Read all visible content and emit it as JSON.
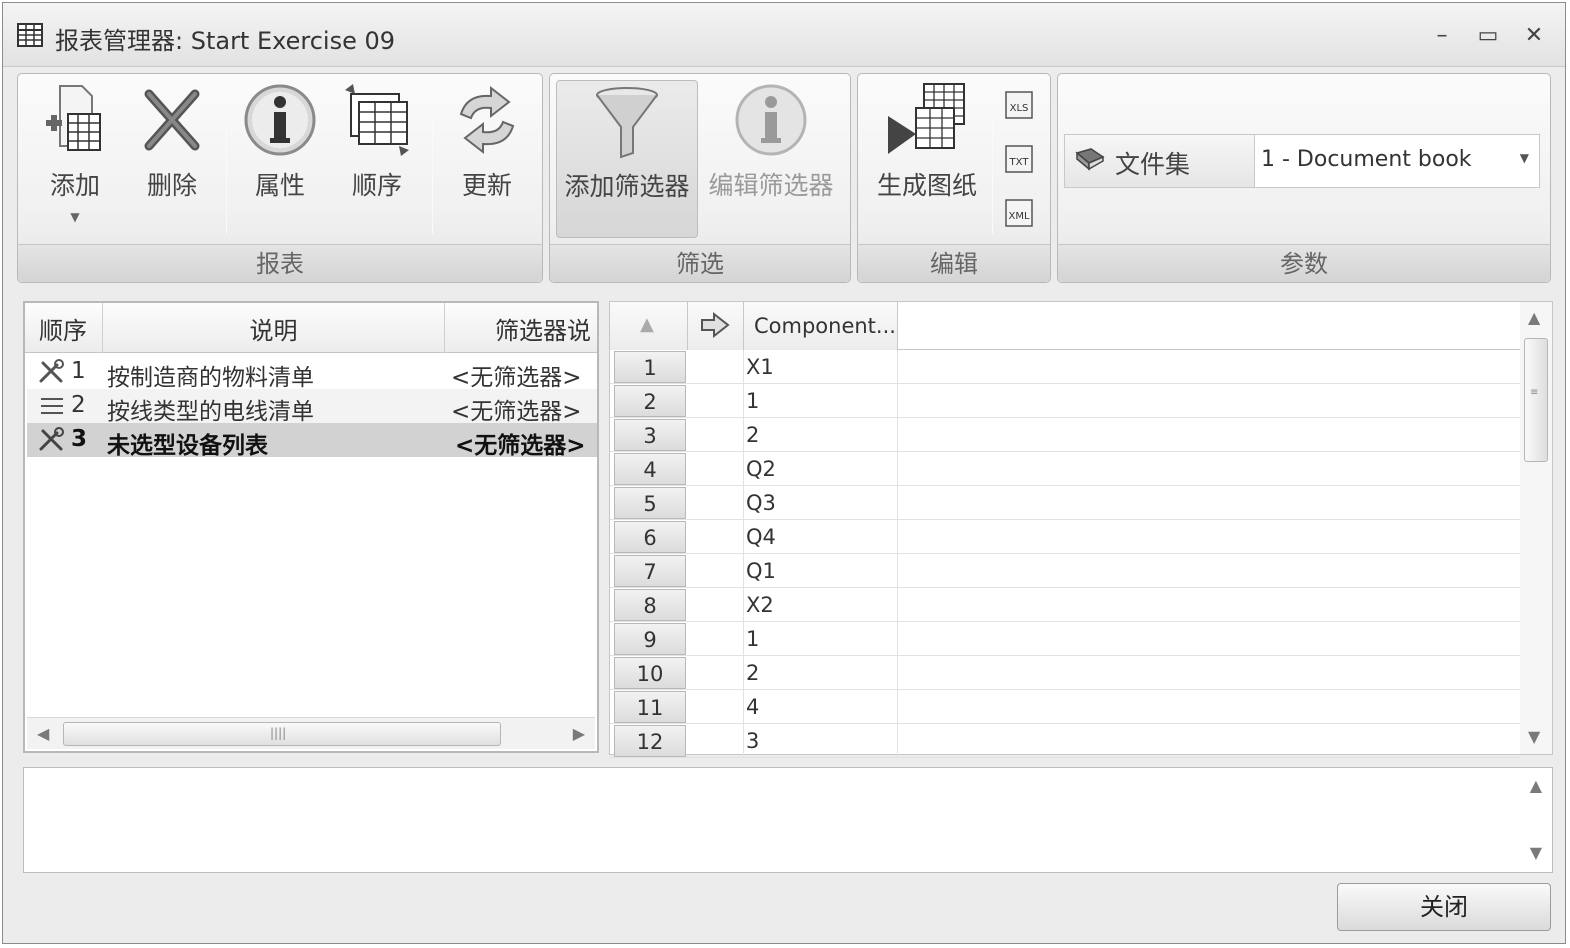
{
  "window": {
    "title": "报表管理器: Start Exercise 09",
    "controls": {
      "minimize": "–",
      "maximize": "▭",
      "close": "✕"
    }
  },
  "ribbon": {
    "groups": {
      "report": {
        "label": "报表",
        "buttons": {
          "add": "添加",
          "delete": "删除",
          "properties": "属性",
          "order": "顺序",
          "update": "更新"
        }
      },
      "filter": {
        "label": "筛选",
        "buttons": {
          "add_filter": "添加筛选器",
          "edit_filter": "编辑筛选器"
        }
      },
      "edit": {
        "label": "编辑",
        "buttons": {
          "generate_drawing": "生成图纸",
          "xls": "XLS",
          "txt": "TXT",
          "xml": "XML"
        }
      },
      "params": {
        "label": "参数",
        "param_label": "文件集",
        "param_value": "1 - Document book"
      }
    }
  },
  "report_list": {
    "columns": [
      "顺序",
      "说明",
      "筛选器说"
    ],
    "rows": [
      {
        "order": "1",
        "description": "按制造商的物料清单",
        "filter": "<无筛选器>",
        "icon": "wrench-icon"
      },
      {
        "order": "2",
        "description": "按线类型的电线清单",
        "filter": "<无筛选器>",
        "icon": "list-icon"
      },
      {
        "order": "3",
        "description": "未选型设备列表",
        "filter": "<无筛选器>",
        "icon": "wrench-icon",
        "selected": true
      }
    ]
  },
  "grid": {
    "header": {
      "sort_icon": "sort-asc-icon",
      "link_icon": "goto-icon",
      "component": "Component..."
    },
    "rows": [
      {
        "n": "1",
        "v": "X1"
      },
      {
        "n": "2",
        "v": "1"
      },
      {
        "n": "3",
        "v": "2"
      },
      {
        "n": "4",
        "v": "Q2"
      },
      {
        "n": "5",
        "v": "Q3"
      },
      {
        "n": "6",
        "v": "Q4"
      },
      {
        "n": "7",
        "v": "Q1"
      },
      {
        "n": "8",
        "v": "X2"
      },
      {
        "n": "9",
        "v": "1"
      },
      {
        "n": "10",
        "v": "2"
      },
      {
        "n": "11",
        "v": "4"
      },
      {
        "n": "12",
        "v": "3"
      }
    ]
  },
  "footer": {
    "close_label": "关闭"
  }
}
